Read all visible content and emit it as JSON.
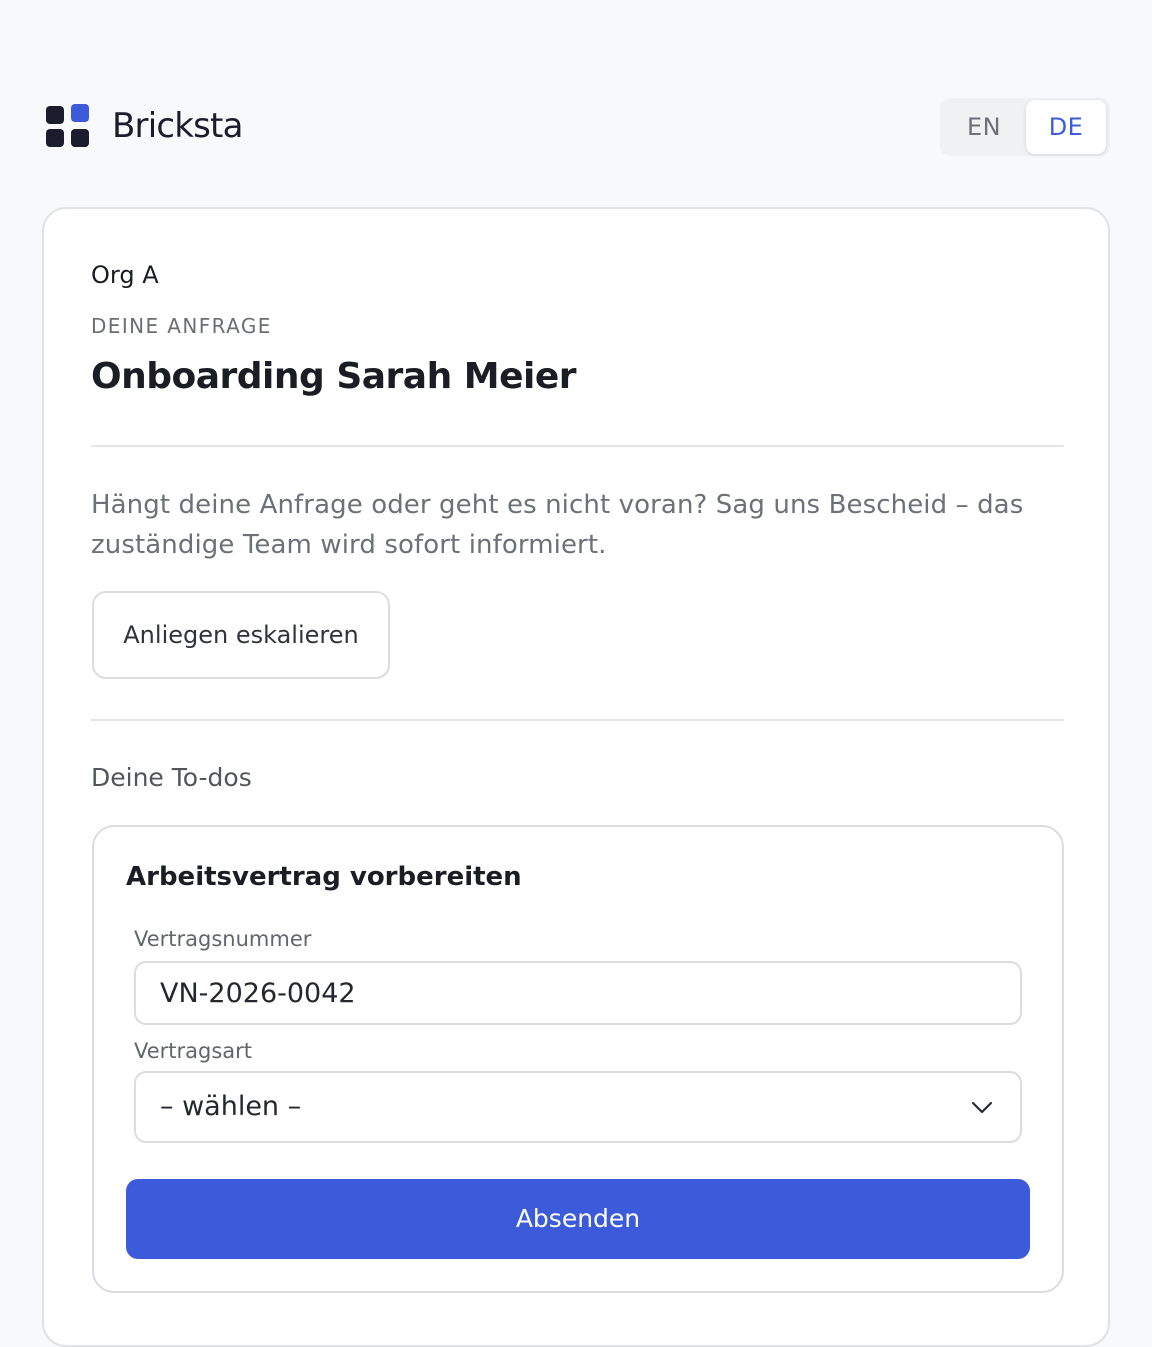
{
  "app": {
    "brand_name": "Bricksta",
    "logo_icon": "four-squares-logo-icon",
    "accent_color": "#3b5bdb"
  },
  "language_switch": {
    "options": [
      "EN",
      "DE"
    ],
    "active": "DE"
  },
  "request": {
    "org": "Org A",
    "eyebrow": "DEINE ANFRAGE",
    "title": "Onboarding Sarah Meier",
    "helper_text": "Hängt deine Anfrage oder geht es nicht voran? Sag uns Bescheid – das zuständige Team wird sofort informiert.",
    "escalate_label": "Anliegen eskalieren"
  },
  "todos": {
    "section_label": "Deine To-dos",
    "items": [
      {
        "title": "Arbeitsvertrag vorbereiten",
        "fields": [
          {
            "label": "Vertragsnummer",
            "value": "VN-2026-0042"
          },
          {
            "label": "Vertragsart",
            "value": "– wählen –",
            "icon": "chevron-down-icon"
          }
        ],
        "submit_label": "Absenden"
      }
    ]
  }
}
